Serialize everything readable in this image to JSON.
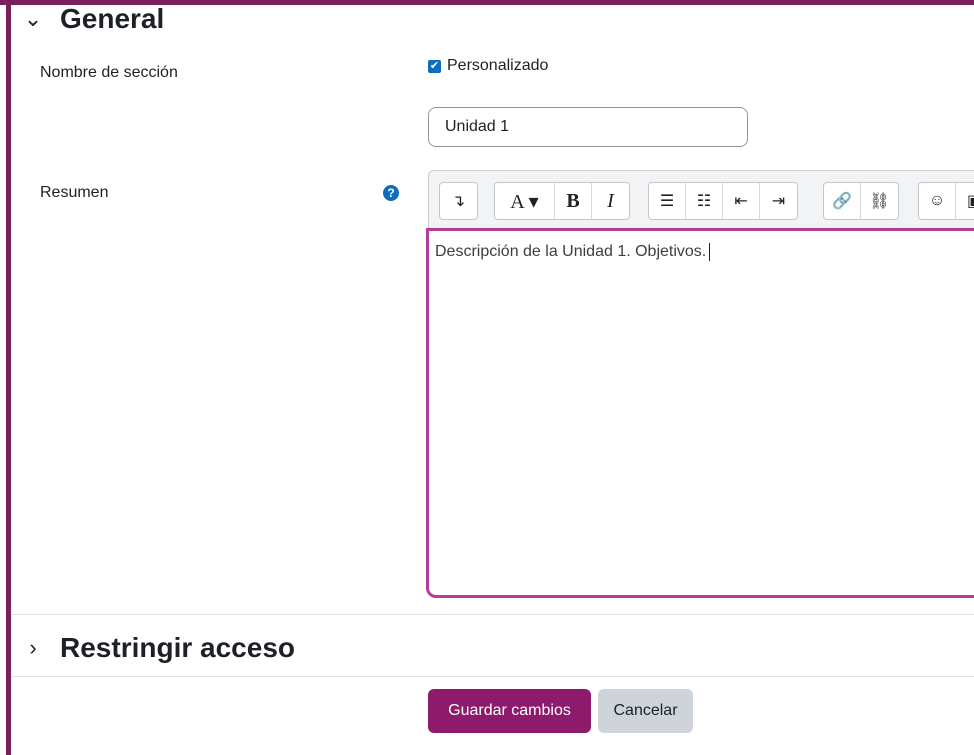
{
  "sections": {
    "general": {
      "title": "General",
      "chevron": "⌄"
    },
    "restrict": {
      "title": "Restringir acceso",
      "chevron": "›"
    }
  },
  "form": {
    "section_name_label": "Nombre de sección",
    "custom_checkbox_label": "Personalizado",
    "custom_checked": true,
    "section_name_value": "Unidad 1",
    "summary_label": "Resumen",
    "help_icon": "question-circle",
    "summary_text": "Descripción de la Unidad 1. Objetivos."
  },
  "toolbar": {
    "collapse": "↴",
    "font_color": "A ▾",
    "bold": "B",
    "italic": "I",
    "unordered_list": "☰",
    "ordered_list": "☷",
    "outdent": "⇤",
    "indent": "⇥",
    "link": "🔗",
    "unlink": "⛓",
    "emoji": "☺",
    "image": "▣"
  },
  "actions": {
    "save_label": "Guardar cambios",
    "cancel_label": "Cancelar"
  },
  "colors": {
    "brand": "#8e1a6c",
    "frame": "#7a1f5c",
    "editor_focus": "#b23f94",
    "checkbox": "#0f6cbf"
  }
}
